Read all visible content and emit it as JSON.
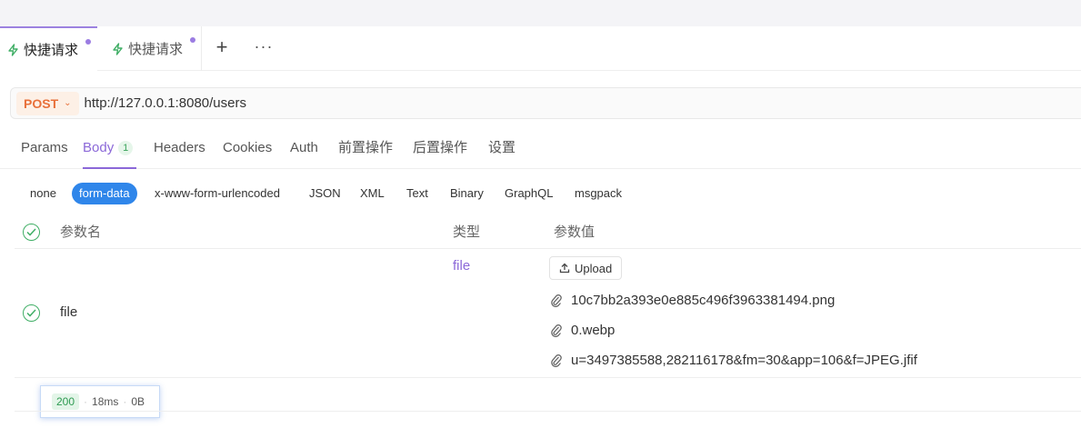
{
  "tabs": [
    {
      "label": "快捷请求",
      "active": true
    },
    {
      "label": "快捷请求",
      "active": false
    }
  ],
  "tab_actions": {
    "add": "+",
    "more": "···"
  },
  "request": {
    "method": "POST",
    "url": "http://127.0.0.1:8080/users"
  },
  "request_tabs": [
    {
      "label": "Params"
    },
    {
      "label": "Body",
      "badge": "1",
      "active": true
    },
    {
      "label": "Headers"
    },
    {
      "label": "Cookies"
    },
    {
      "label": "Auth"
    },
    {
      "label": "前置操作"
    },
    {
      "label": "后置操作"
    },
    {
      "label": "设置"
    }
  ],
  "body_types": [
    "none",
    "form-data",
    "x-www-form-urlencoded",
    "JSON",
    "XML",
    "Text",
    "Binary",
    "GraphQL",
    "msgpack"
  ],
  "body_type_selected": "form-data",
  "table": {
    "headers": {
      "name": "参数名",
      "type": "类型",
      "value": "参数值"
    },
    "rows": [
      {
        "checked": true,
        "name": "file",
        "type": "file",
        "upload_label": "Upload",
        "files": [
          "10c7bb2a393e0e885c496f3963381494.png",
          "0.webp",
          "u=3497385588,282116178&fm=30&app=106&f=JPEG.jfif"
        ]
      }
    ]
  },
  "response_status": {
    "code": "200",
    "time": "18ms",
    "size": "0B"
  },
  "colors": {
    "accent": "#8b68d8",
    "method": "#e8703a",
    "selected_pill": "#2f86ea",
    "success": "#3fae65"
  }
}
